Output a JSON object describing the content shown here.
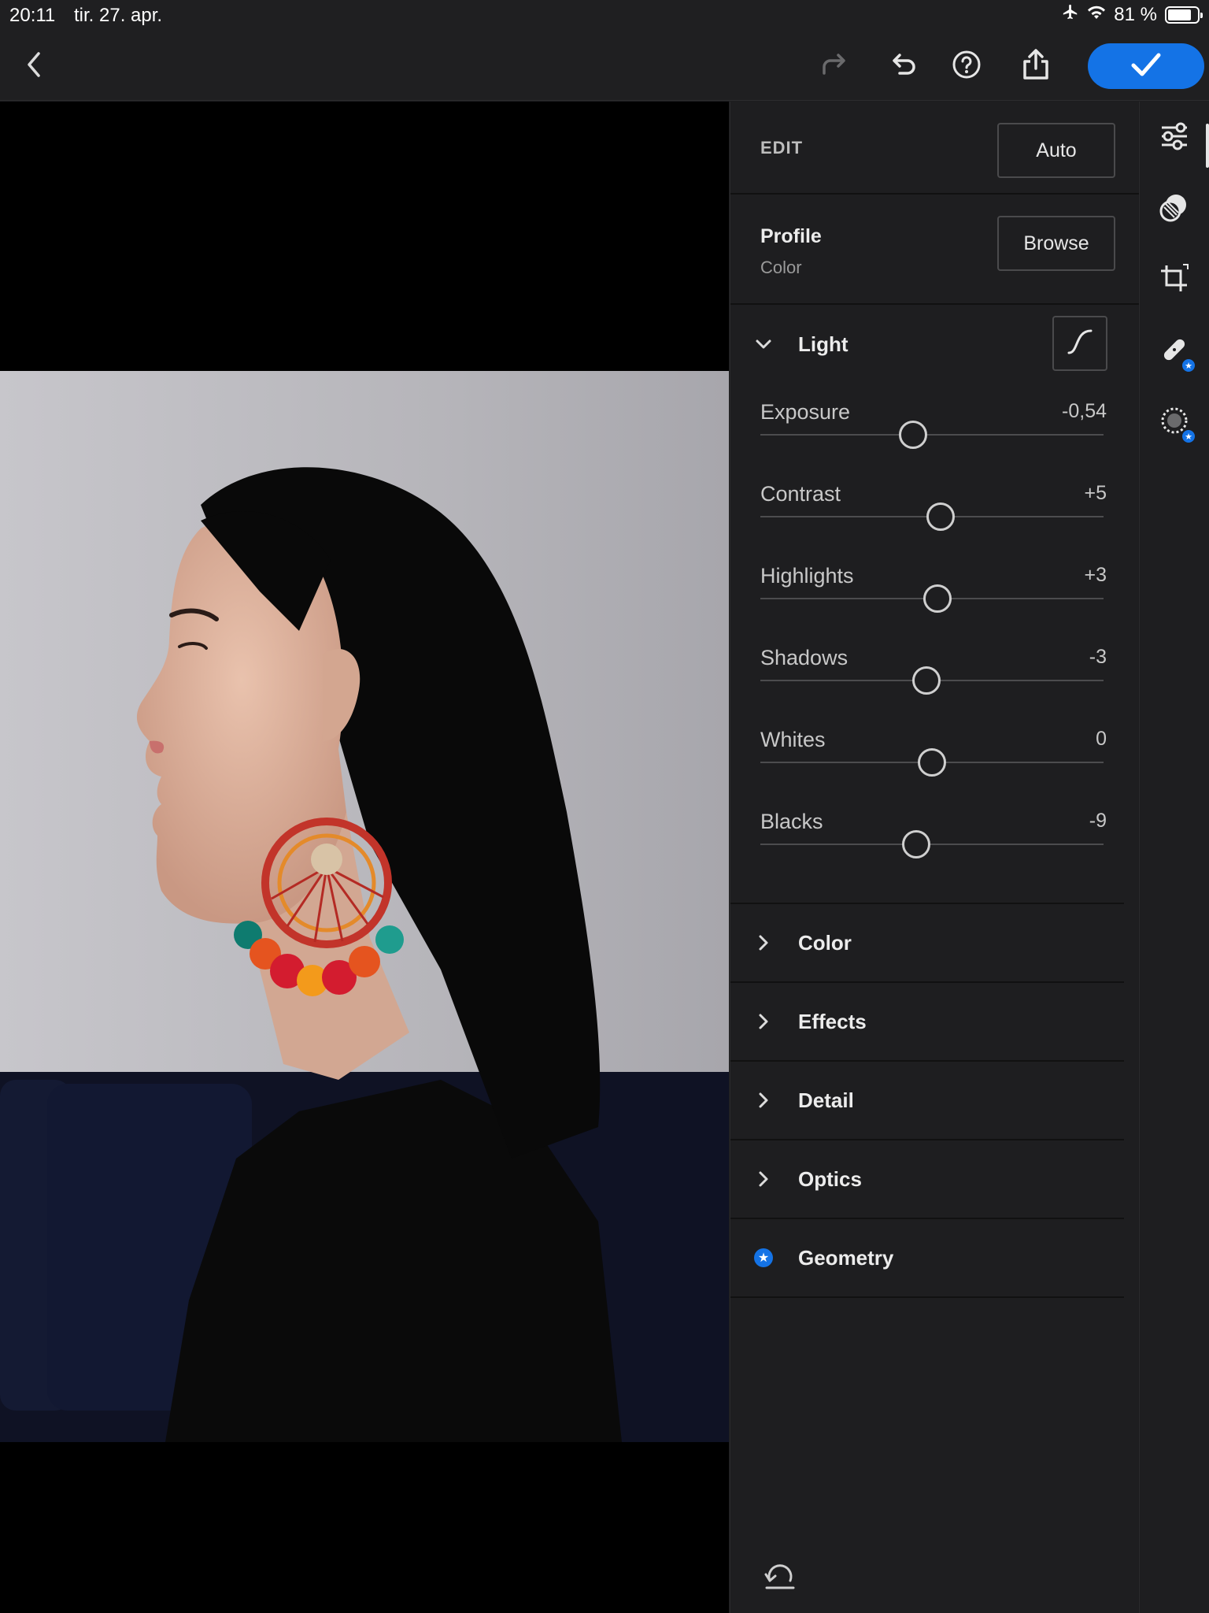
{
  "status_bar": {
    "time": "20:11",
    "date": "tir. 27. apr.",
    "battery": "81 %",
    "battery_level": 0.81
  },
  "toolbar": {
    "back": "chevron-left-icon",
    "redo": "redo-icon",
    "undo": "undo-icon",
    "help": "help-icon",
    "share": "share-icon",
    "done": "checkmark-icon"
  },
  "panel": {
    "edit_label": "EDIT",
    "auto_label": "Auto",
    "profile_title": "Profile",
    "profile_value": "Color",
    "browse_label": "Browse",
    "light": {
      "label": "Light",
      "sliders": [
        {
          "name": "Exposure",
          "value": "-0,54",
          "level": -0.108
        },
        {
          "name": "Contrast",
          "value": "+5",
          "level": 0.05
        },
        {
          "name": "Highlights",
          "value": "+3",
          "level": 0.03
        },
        {
          "name": "Shadows",
          "value": "-3",
          "level": -0.03
        },
        {
          "name": "Whites",
          "value": "0",
          "level": 0.0
        },
        {
          "name": "Blacks",
          "value": "-9",
          "level": -0.09
        }
      ]
    },
    "groups": [
      {
        "label": "Color"
      },
      {
        "label": "Effects"
      },
      {
        "label": "Detail"
      },
      {
        "label": "Optics"
      },
      {
        "label": "Geometry"
      }
    ]
  },
  "colors": {
    "accent": "#1473e6",
    "panel_bg": "#1e1e20"
  }
}
